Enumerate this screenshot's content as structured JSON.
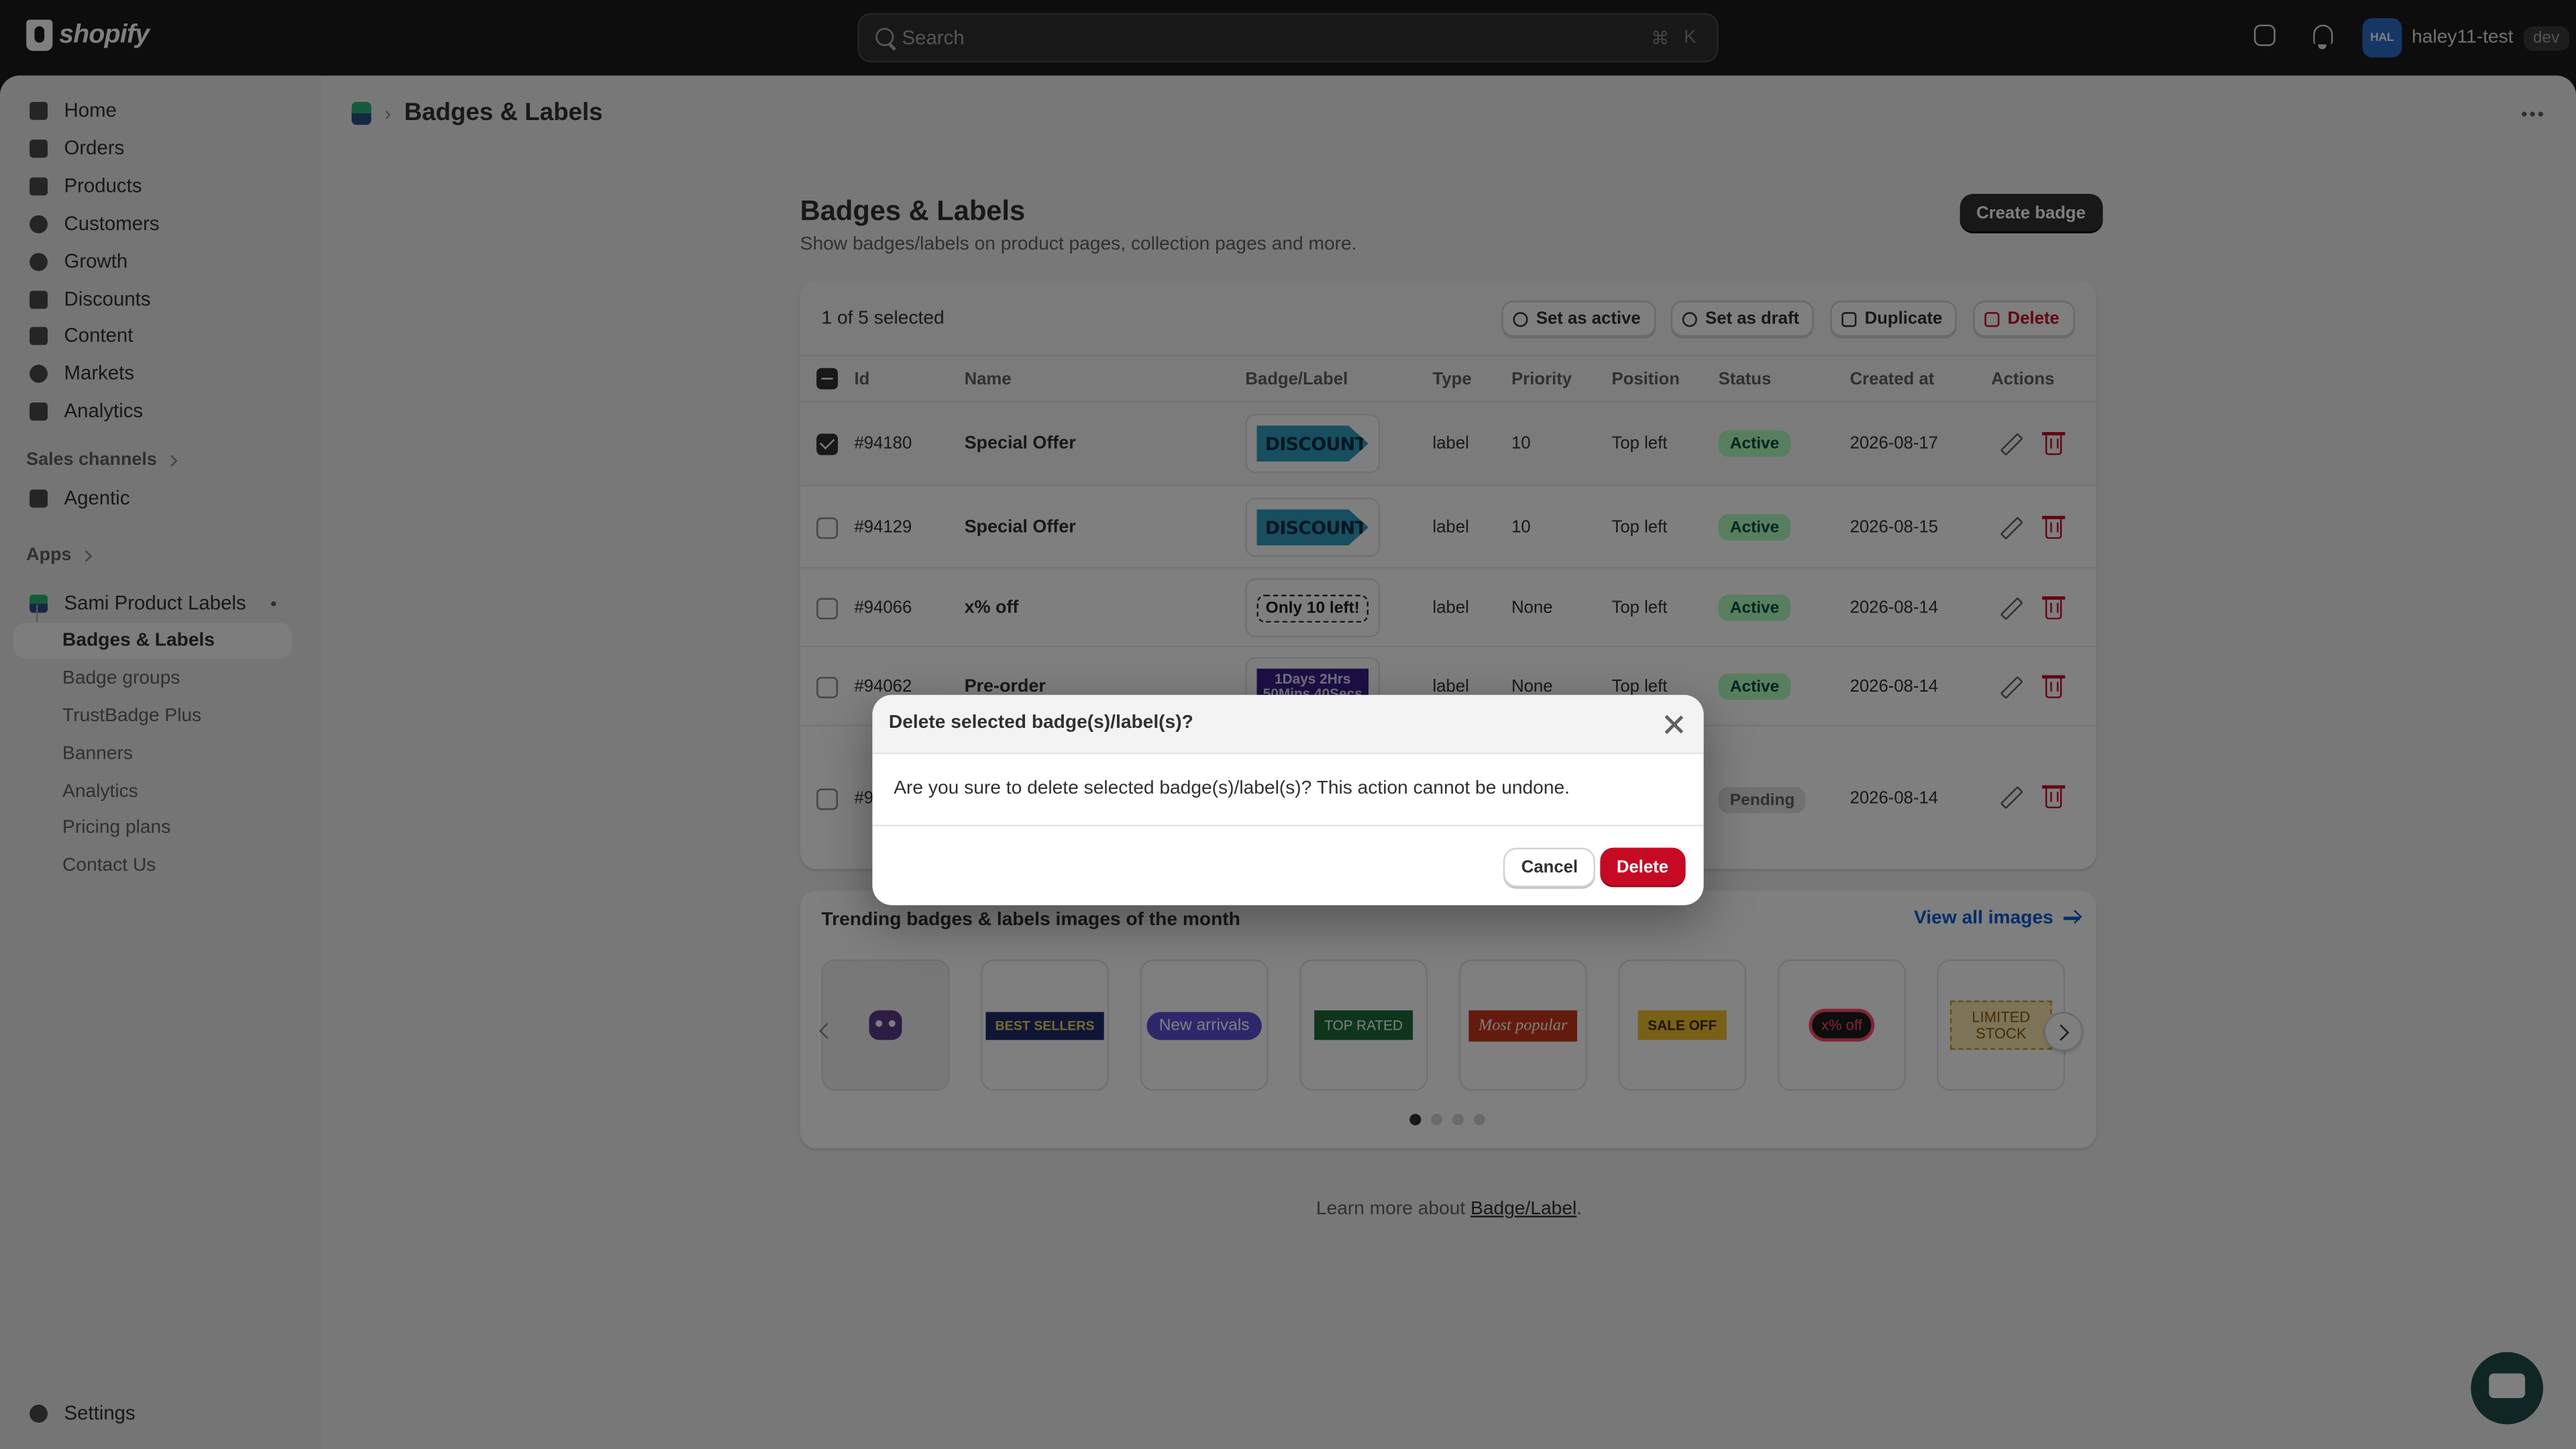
{
  "topbar": {
    "logo_text": "shopify",
    "search_placeholder": "Search",
    "shortcut_cmd": "⌘",
    "shortcut_key": "K",
    "avatar_initials": "HAL",
    "user_name": "haley11-test",
    "env_badge": "dev"
  },
  "sidebar": {
    "items": [
      {
        "label": "Home",
        "icon": "home-icon"
      },
      {
        "label": "Orders",
        "icon": "orders-icon"
      },
      {
        "label": "Products",
        "icon": "tag-icon"
      },
      {
        "label": "Customers",
        "icon": "person-icon"
      },
      {
        "label": "Growth",
        "icon": "growth-icon"
      },
      {
        "label": "Discounts",
        "icon": "discount-icon"
      },
      {
        "label": "Content",
        "icon": "content-icon"
      },
      {
        "label": "Markets",
        "icon": "globe-icon"
      },
      {
        "label": "Analytics",
        "icon": "chart-icon"
      }
    ],
    "sales_channels_label": "Sales channels",
    "agentic_label": "Agentic",
    "apps_label": "Apps",
    "app_name": "Sami Product Labels",
    "app_subitems": [
      "Badges & Labels",
      "Badge groups",
      "TrustBadge Plus",
      "Banners",
      "Analytics",
      "Pricing plans",
      "Contact Us"
    ],
    "settings_label": "Settings"
  },
  "header": {
    "app_title": "Badges & Labels"
  },
  "page": {
    "title": "Badges & Labels",
    "subtitle": "Show badges/labels on product pages, collection pages and more.",
    "create_button": "Create badge"
  },
  "bulk": {
    "selection_text": "1 of 5 selected",
    "set_active": "Set as active",
    "set_draft": "Set as draft",
    "duplicate": "Duplicate",
    "delete": "Delete"
  },
  "table": {
    "columns": [
      "Id",
      "Name",
      "Badge/Label",
      "Type",
      "Priority",
      "Position",
      "Status",
      "Created at",
      "Actions"
    ],
    "rows": [
      {
        "id": "#94180",
        "name": "Special Offer",
        "badge": "DISCOUNT",
        "type": "label",
        "priority": "10",
        "position": "Top left",
        "status": "Active",
        "created": "2026-08-17",
        "checked": true
      },
      {
        "id": "#94129",
        "name": "Special Offer",
        "badge": "DISCOUNT",
        "type": "label",
        "priority": "10",
        "position": "Top left",
        "status": "Active",
        "created": "2026-08-15",
        "checked": false
      },
      {
        "id": "#94066",
        "name": "x% off",
        "badge": "Only 10 left!",
        "type": "label",
        "priority": "None",
        "position": "Top left",
        "status": "Active",
        "created": "2026-08-14",
        "checked": false
      },
      {
        "id": "#94062",
        "name": "Pre-order",
        "badge": "1Days 2Hrs 50Mins 40Secs",
        "type": "label",
        "priority": "None",
        "position": "Top left",
        "status": "Active",
        "created": "2026-08-14",
        "checked": false
      },
      {
        "id": "#9",
        "name": "",
        "badge": "",
        "type": "",
        "priority": "",
        "position": "",
        "status": "Pending",
        "created": "2026-08-14",
        "checked": false
      }
    ]
  },
  "trending": {
    "title": "Trending badges & labels images of the month",
    "view_all": "View all images",
    "tiles": [
      {
        "label": "",
        "icon": "robot-icon"
      },
      {
        "label": "BEST SELLERS",
        "bg": "#1f2a6b",
        "fg": "#f5d36b"
      },
      {
        "label": "New arrivals",
        "bg": "#5b4fd6",
        "fg": "#ffffff"
      },
      {
        "label": "TOP RATED",
        "bg": "#1f6b3a",
        "fg": "#ffffff"
      },
      {
        "label": "Most popular",
        "bg": "#c8361b",
        "fg": "#ffffff"
      },
      {
        "label": "SALE OFF",
        "bg": "#f3c12e",
        "fg": "#3a2a00"
      },
      {
        "label": "x% off",
        "bg": "#1a1a1a",
        "fg": "#ff4d6d"
      },
      {
        "label": "LIMITED STOCK",
        "bg": "#fbe8b0",
        "fg": "#8a5a00"
      }
    ]
  },
  "footer": {
    "learn_prefix": "Learn more about ",
    "learn_link": "Badge/Label",
    "learn_suffix": "."
  },
  "modal": {
    "title": "Delete selected badge(s)/label(s)?",
    "body": "Are you sure to delete selected badge(s)/label(s)? This action cannot be undone.",
    "cancel": "Cancel",
    "delete": "Delete"
  },
  "colors": {
    "critical": "#c70a24",
    "success_bg": "#affebf",
    "success_fg": "#014b40",
    "link": "#005bd3"
  }
}
